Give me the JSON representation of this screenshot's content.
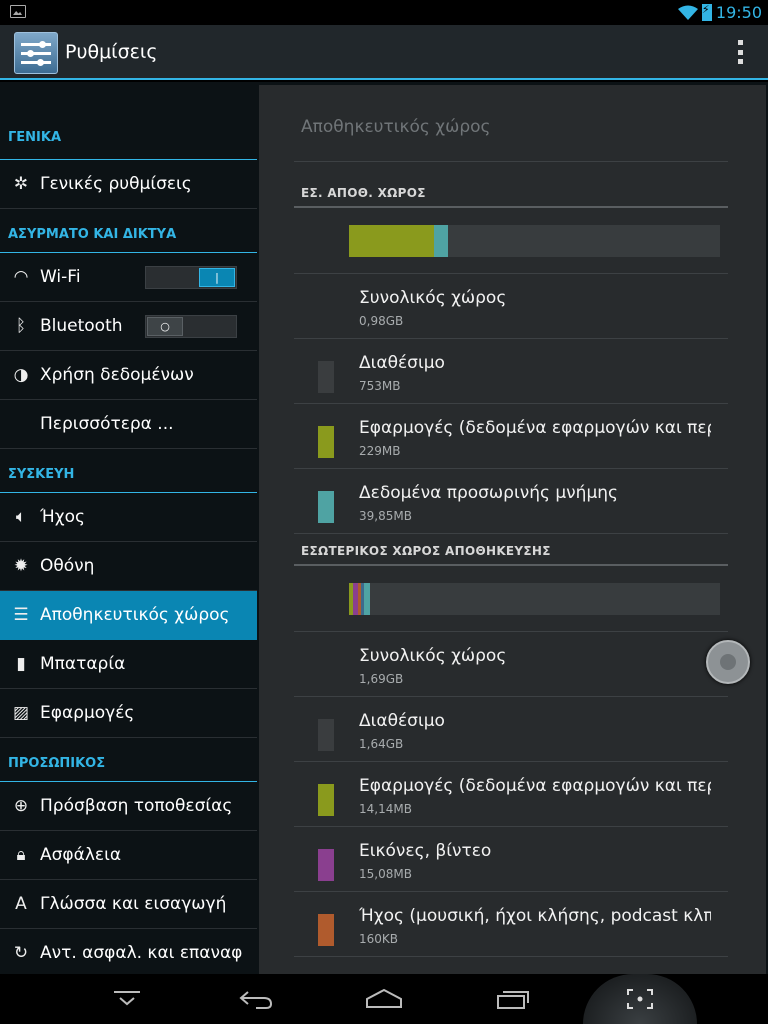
{
  "status_bar": {
    "time": "19:50"
  },
  "action_bar": {
    "title": "Ρυθμίσεις"
  },
  "sidebar": {
    "sections": [
      {
        "header": "ΓΕΝΙΚΑ",
        "items": [
          {
            "label": "Γενικές ρυθμίσεις",
            "icon": "gear-icon"
          }
        ]
      },
      {
        "header": "ΑΣΥΡΜΑΤΟ ΚΑΙ ΔΙΚΤΥΑ",
        "items": [
          {
            "label": "Wi-Fi",
            "icon": "wifi-icon",
            "toggle": "on",
            "toggle_text": "|"
          },
          {
            "label": "Bluetooth",
            "icon": "bluetooth-icon",
            "toggle": "off",
            "toggle_text": "○"
          },
          {
            "label": "Χρήση δεδομένων",
            "icon": "data-usage-icon"
          },
          {
            "label": "Περισσότερα ...",
            "icon": ""
          }
        ]
      },
      {
        "header": "ΣΥΣΚΕΥΗ",
        "items": [
          {
            "label": "Ήχος",
            "icon": "speaker-icon"
          },
          {
            "label": "Οθόνη",
            "icon": "brightness-icon"
          },
          {
            "label": "Αποθηκευτικός χώρος",
            "icon": "storage-icon",
            "selected": true
          },
          {
            "label": "Μπαταρία",
            "icon": "battery-icon"
          },
          {
            "label": "Εφαρμογές",
            "icon": "apps-icon"
          }
        ]
      },
      {
        "header": "ΠΡΟΣΩΠΙΚΟΣ",
        "items": [
          {
            "label": "Πρόσβαση τοποθεσίας",
            "icon": "location-icon"
          },
          {
            "label": "Ασφάλεια",
            "icon": "lock-icon"
          },
          {
            "label": "Γλώσσα και εισαγωγή",
            "icon": "language-icon"
          },
          {
            "label": "Αντ. ασφαλ. και επαναφ",
            "icon": "backup-icon"
          }
        ]
      }
    ]
  },
  "detail": {
    "title": "Αποθηκευτικός χώρος",
    "sd_card": {
      "header": "ΕΣ. ΑΠΟΘ. ΧΩΡΟΣ",
      "usage_bar": [
        {
          "color": "#8a9a1d",
          "fraction": 0.228
        },
        {
          "color": "#4fa3a3",
          "fraction": 0.04
        }
      ],
      "rows": [
        {
          "title": "Συνολικός χώρος",
          "value": "0,98GB",
          "color": null
        },
        {
          "title": "Διαθέσιμο",
          "value": "753MB",
          "color": "#3a3d3f"
        },
        {
          "title": "Εφαρμογές (δεδομένα εφαρμογών και περιεχόμενο πολυμέσων)",
          "value": "229MB",
          "color": "#8a9a1d"
        },
        {
          "title": "Δεδομένα προσωρινής μνήμης",
          "value": "39,85MB",
          "color": "#4fa3a3"
        }
      ]
    },
    "internal": {
      "header": "ΕΣΩΤΕΡΙΚΟΣ ΧΩΡΟΣ ΑΠΟΘΗΚΕΥΣΗΣ",
      "usage_bar": [
        {
          "color": "#8a9a1d",
          "fraction": 0.012
        },
        {
          "color": "#8a3f8f",
          "fraction": 0.012
        },
        {
          "color": "#b05b2d",
          "fraction": 0.008
        },
        {
          "color": "#3d6a8c",
          "fraction": 0.008
        },
        {
          "color": "#4fa3a3",
          "fraction": 0.016
        }
      ],
      "rows": [
        {
          "title": "Συνολικός χώρος",
          "value": "1,69GB",
          "color": null
        },
        {
          "title": "Διαθέσιμο",
          "value": "1,64GB",
          "color": "#3a3d3f"
        },
        {
          "title": "Εφαρμογές (δεδομένα εφαρμογών και περιεχόμενο πολυμέσων)",
          "value": "14,14MB",
          "color": "#8a9a1d"
        },
        {
          "title": "Εικόνες, βίντεο",
          "value": "15,08MB",
          "color": "#8a3f8f"
        },
        {
          "title": "Ήχος (μουσική, ήχοι κλήσης, podcast κλπ.)",
          "value": "160KB",
          "color": "#b05b2d"
        }
      ]
    }
  }
}
